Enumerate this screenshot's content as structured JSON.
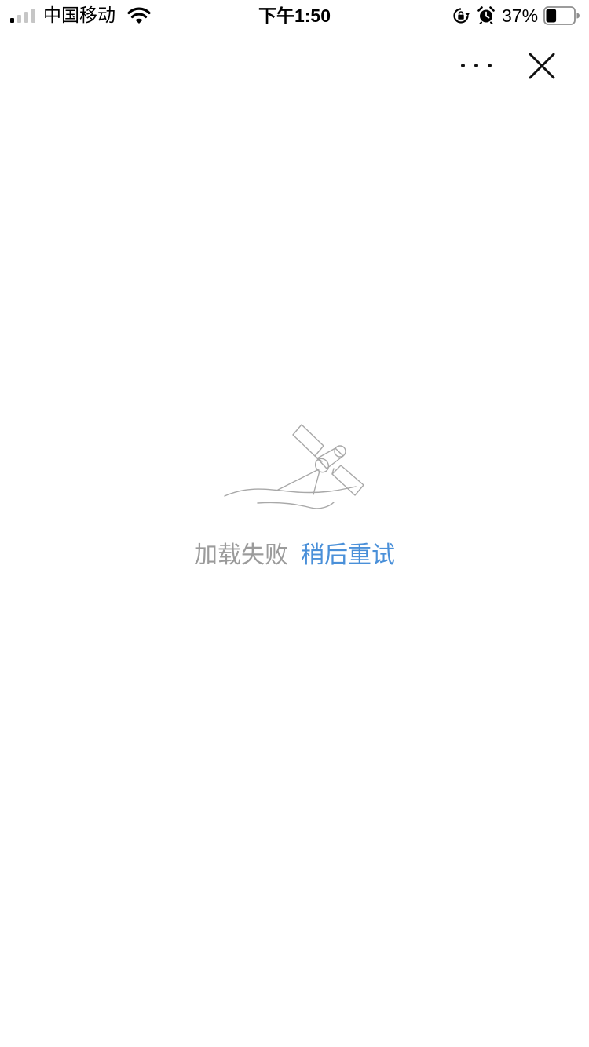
{
  "status_bar": {
    "carrier": "中国移动",
    "time": "下午1:50",
    "battery_percent": "37%",
    "battery_level": 0.37,
    "icons": [
      "signal-icon",
      "wifi-icon",
      "orientation-lock-icon",
      "alarm-icon",
      "battery-icon"
    ]
  },
  "nav": {
    "icons": [
      "more-icon",
      "close-icon"
    ]
  },
  "error_state": {
    "icon": "satellite-icon",
    "message": "加载失败",
    "retry_label": "稍后重试"
  },
  "colors": {
    "message": "#9b9b9b",
    "retry_link": "#4a90d9",
    "illustration": "#a8a8a8"
  }
}
